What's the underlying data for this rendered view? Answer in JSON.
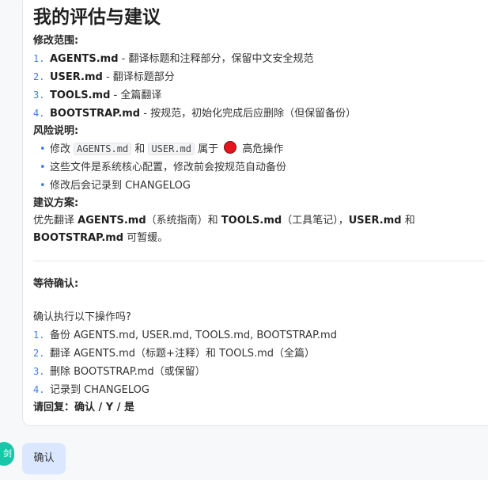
{
  "heading": "我的评估与建议",
  "scope": {
    "label": "修改范围:",
    "items": [
      {
        "num": "1.",
        "file": "AGENTS.md",
        "desc": " - 翻译标题和注释部分，保留中文安全规范"
      },
      {
        "num": "2.",
        "file": "USER.md",
        "desc": " - 翻译标题部分"
      },
      {
        "num": "3.",
        "file": "TOOLS.md",
        "desc": " - 全篇翻译"
      },
      {
        "num": "4.",
        "file": "BOOTSTRAP.md",
        "desc": " - 按规范，初始化完成后应删除（但保留备份）"
      }
    ]
  },
  "risk": {
    "label": "风险说明:",
    "bullet": "•",
    "item1": {
      "prefix": "修改 ",
      "code1": "AGENTS.md",
      "mid": " 和 ",
      "code2": "USER.md",
      "suffix1": " 属于 ",
      "suffix2": " 高危操作",
      "dot_color": "#e5151d"
    },
    "item2": "这些文件是系统核心配置，修改前会按规范自动备份",
    "item3": "修改后会记录到 CHANGELOG"
  },
  "suggestion": {
    "label": "建议方案:",
    "line1": {
      "t1": "优先翻译 ",
      "b1": "AGENTS.md",
      "t2": "（系统指南）和 ",
      "b2": "TOOLS.md",
      "t3": "（工具笔记），",
      "b3": "USER.md",
      "t4": " 和"
    },
    "line2": {
      "b1": "BOOTSTRAP.md",
      "t1": " 可暂缓。"
    }
  },
  "confirm": {
    "label": "等待确认:",
    "question": "确认执行以下操作吗?",
    "steps": [
      {
        "num": "1.",
        "text": "备份 AGENTS.md, USER.md, TOOLS.md, BOOTSTRAP.md"
      },
      {
        "num": "2.",
        "text": "翻译 AGENTS.md（标题+注释）和 TOOLS.md（全篇）"
      },
      {
        "num": "3.",
        "text": "删除 BOOTSTRAP.md（或保留）"
      },
      {
        "num": "4.",
        "text": "记录到 CHANGELOG"
      }
    ],
    "reply": "请回复：确认 / Y / 是"
  },
  "user": {
    "avatar_text": "剑",
    "message": "确认"
  },
  "colors": {
    "accent": "#3d7be5",
    "danger": "#e5151d",
    "bubble": "#dbe7ff",
    "avatar": "#18c6a8"
  }
}
